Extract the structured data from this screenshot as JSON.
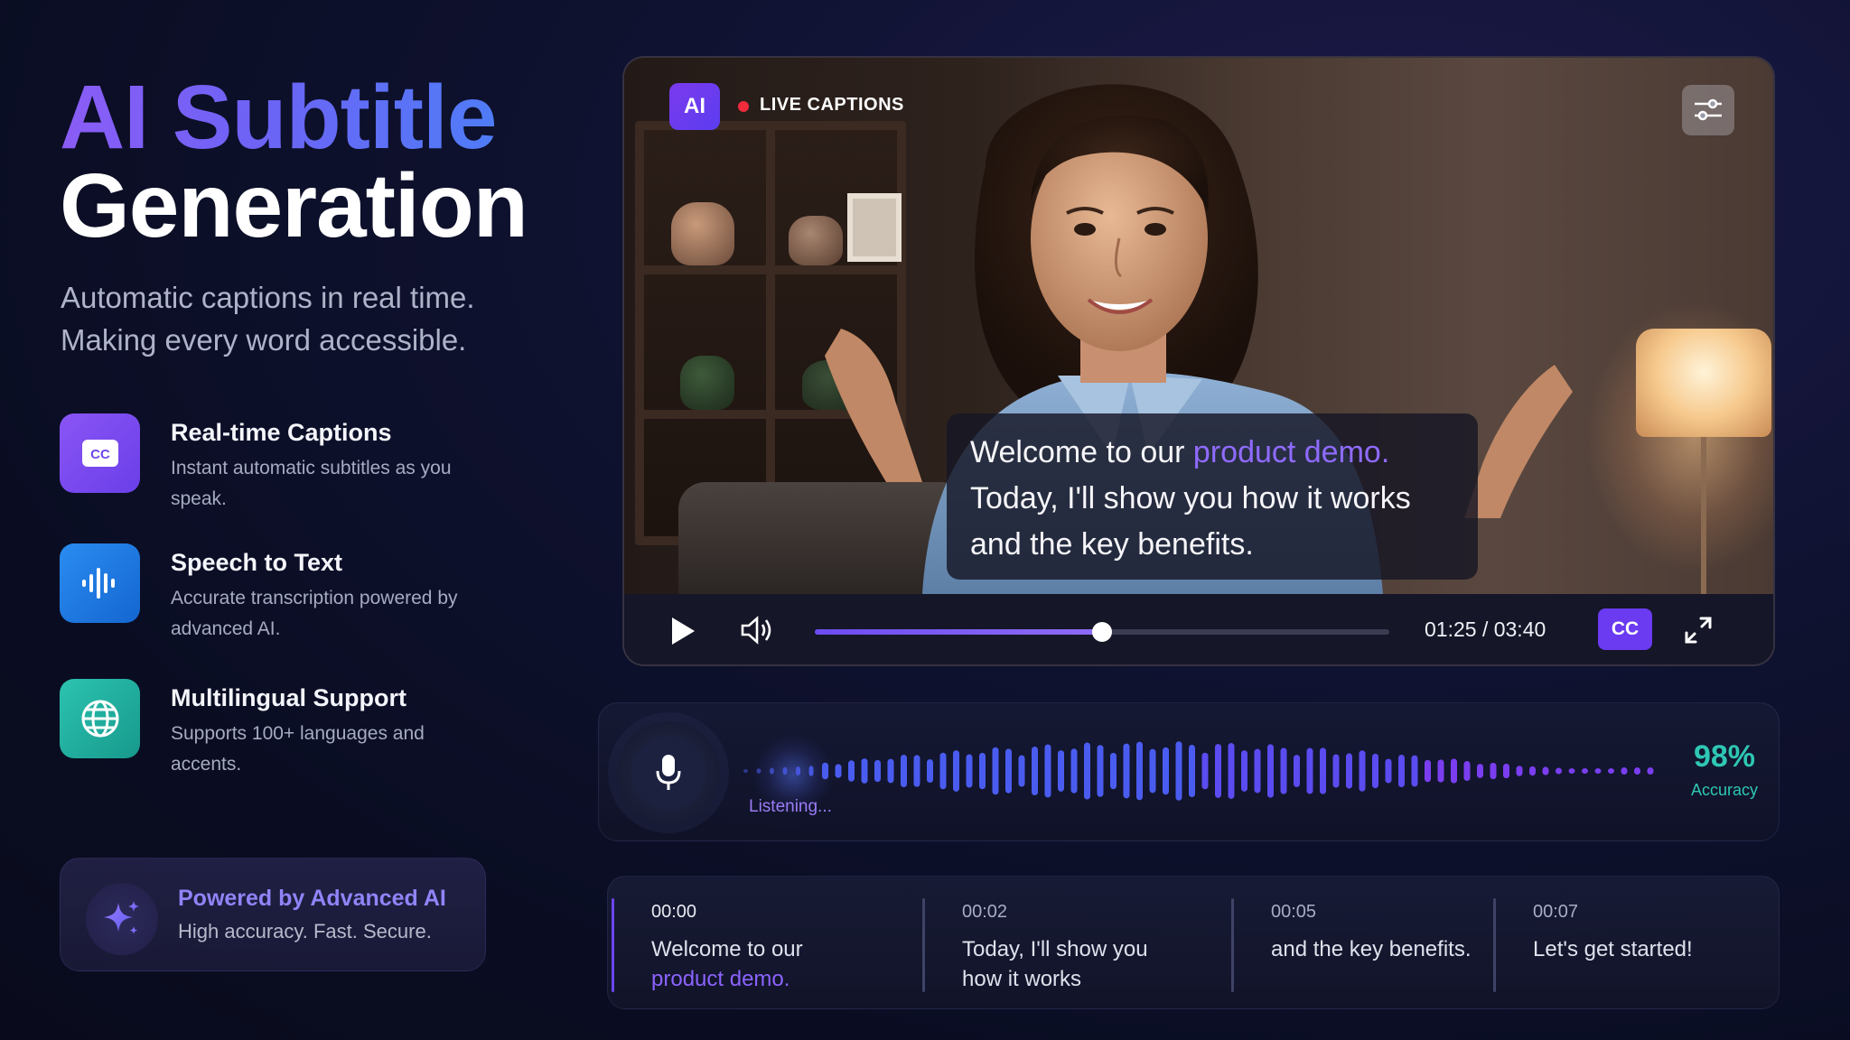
{
  "hero": {
    "title_line1": "AI Subtitle",
    "title_line2": "Generation",
    "subtitle_line1": "Automatic captions in real time.",
    "subtitle_line2": "Making every word accessible."
  },
  "features": [
    {
      "icon": "cc-icon",
      "color": "#7b4ef0",
      "title": "Real-time Captions",
      "desc": "Instant automatic subtitles as you speak."
    },
    {
      "icon": "waveform-icon",
      "color": "#1f7fe3",
      "title": "Speech to Text",
      "desc": "Accurate transcription powered by advanced AI."
    },
    {
      "icon": "globe-icon",
      "color": "#22b3a3",
      "title": "Multilingual Support",
      "desc": "Supports 100+ languages and accents."
    }
  ],
  "powered": {
    "title": "Powered by Advanced AI",
    "subtitle": "High accuracy. Fast. Secure."
  },
  "player": {
    "ai_badge": "AI",
    "live_label": "LIVE CAPTIONS",
    "caption": {
      "line1_prefix": "Welcome to our ",
      "line1_highlight": "product demo.",
      "line2": "Today, I'll show you how it works",
      "line3": "and the key benefits."
    },
    "current_time": "01:25",
    "duration": "03:40",
    "time_display": "01:25 / 03:40",
    "progress": 0.5,
    "cc_label": "CC"
  },
  "waveform": {
    "status": "Listening...",
    "accuracy_value": "98%",
    "accuracy_label": "Accuracy"
  },
  "transcript": [
    {
      "time": "00:00",
      "text_prefix": "Welcome to our",
      "text_highlight": "product demo.",
      "active": true
    },
    {
      "time": "00:02",
      "text_prefix": "Today, I'll show you how it works",
      "text_highlight": "",
      "active": false
    },
    {
      "time": "00:05",
      "text_prefix": "and the key benefits.",
      "text_highlight": "",
      "active": false
    },
    {
      "time": "00:07",
      "text_prefix": "Let's get started!",
      "text_highlight": "",
      "active": false
    }
  ],
  "colors": {
    "accent": "#6a3bf0",
    "accuracy": "#2ec7b3",
    "live": "#ef2b3c"
  }
}
